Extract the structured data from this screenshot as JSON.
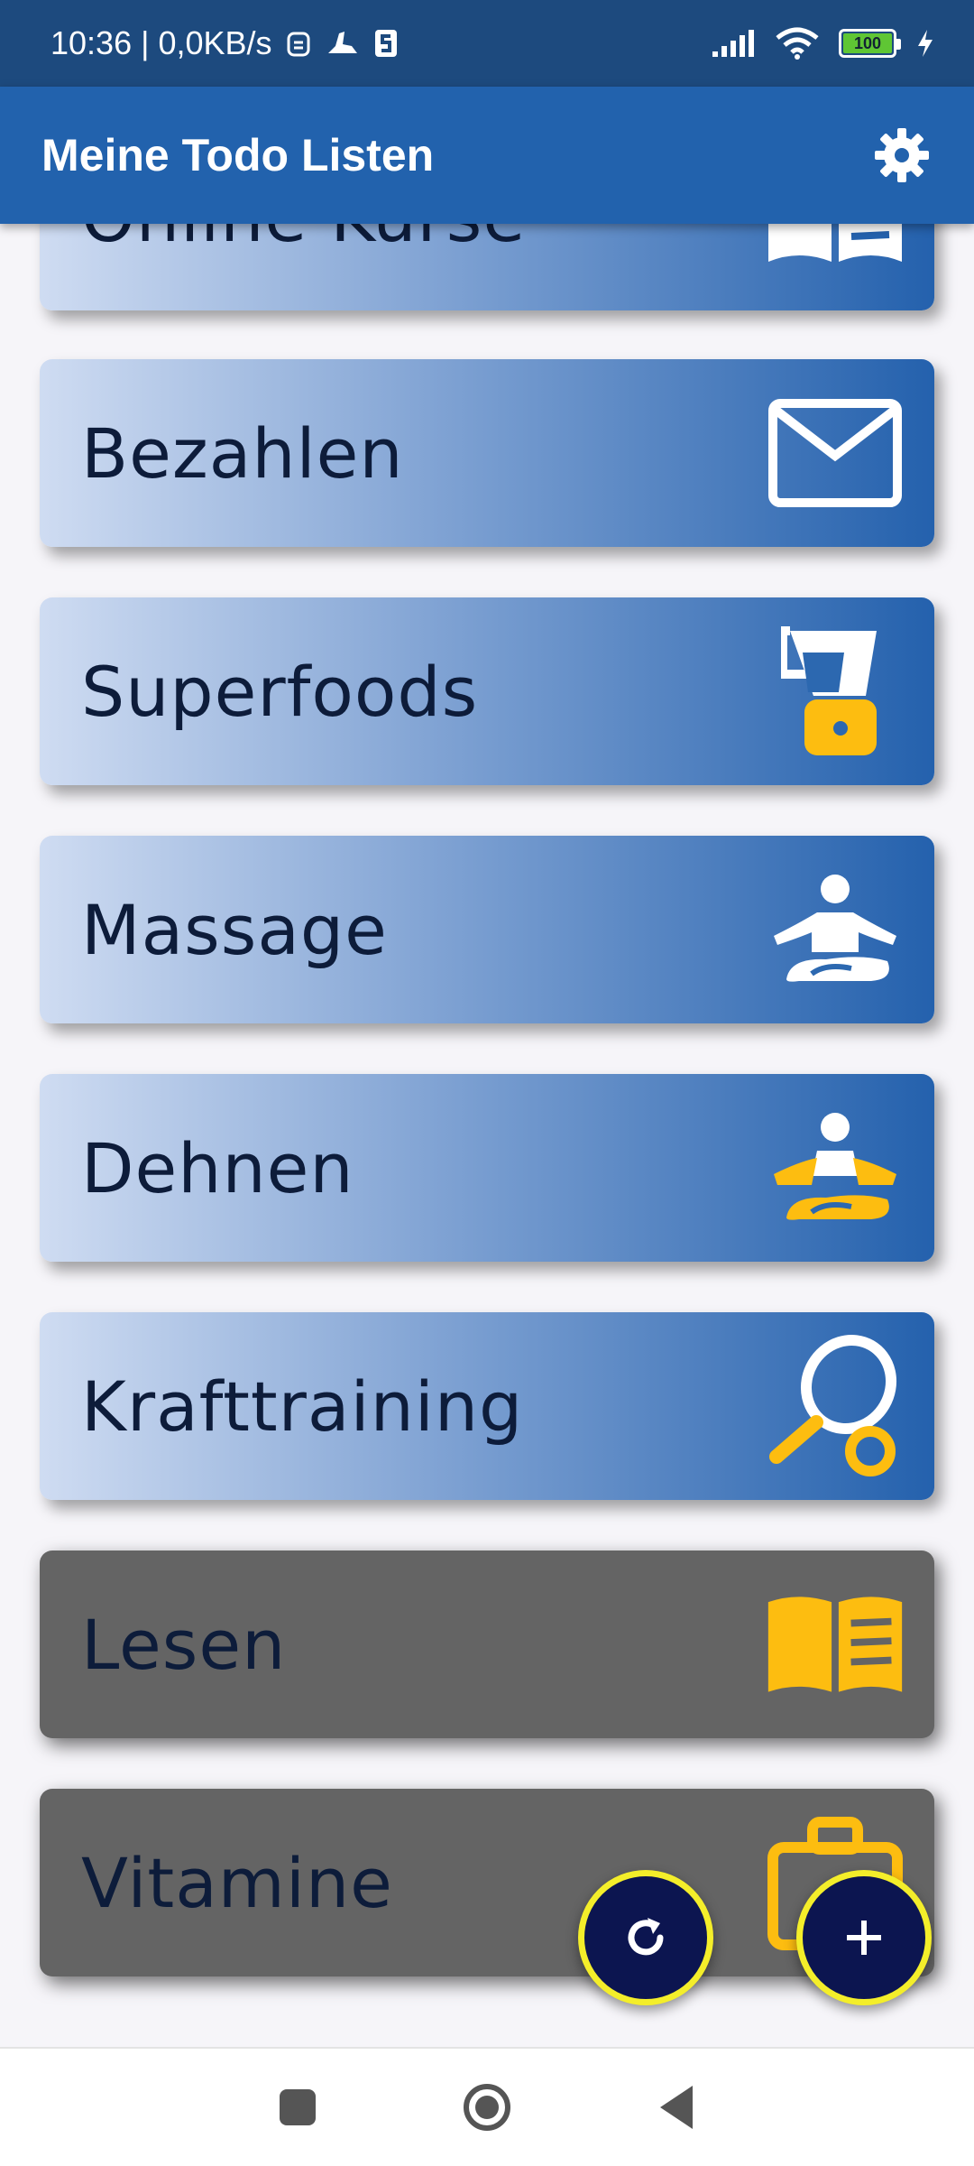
{
  "status_bar": {
    "time_speed": "10:36 | 0,0KB/s",
    "battery": "100"
  },
  "app_bar": {
    "title": "Meine Todo Listen",
    "settings_icon": "gear-icon"
  },
  "lists": [
    {
      "label": "Online Kurse",
      "icon": "book-icon",
      "state": "active"
    },
    {
      "label": "Bezahlen",
      "icon": "envelope-icon",
      "state": "active"
    },
    {
      "label": "Superfoods",
      "icon": "blender-icon",
      "state": "active"
    },
    {
      "label": "Massage",
      "icon": "meditation-icon",
      "state": "active"
    },
    {
      "label": "Dehnen",
      "icon": "meditation-icon",
      "state": "active"
    },
    {
      "label": "Krafttraining",
      "icon": "racket-ball-icon",
      "state": "active"
    },
    {
      "label": "Lesen",
      "icon": "book-icon",
      "state": "inactive"
    },
    {
      "label": "Vitamine",
      "icon": "briefcase-icon",
      "state": "inactive"
    }
  ],
  "fabs": {
    "refresh_icon": "refresh-icon",
    "add_icon": "plus-icon"
  },
  "colors": {
    "accent_yellow": "#fdbd10",
    "fab_border": "#f4ee2a",
    "app_bar": "#2262ad",
    "status_bar": "#1d4a7e"
  }
}
